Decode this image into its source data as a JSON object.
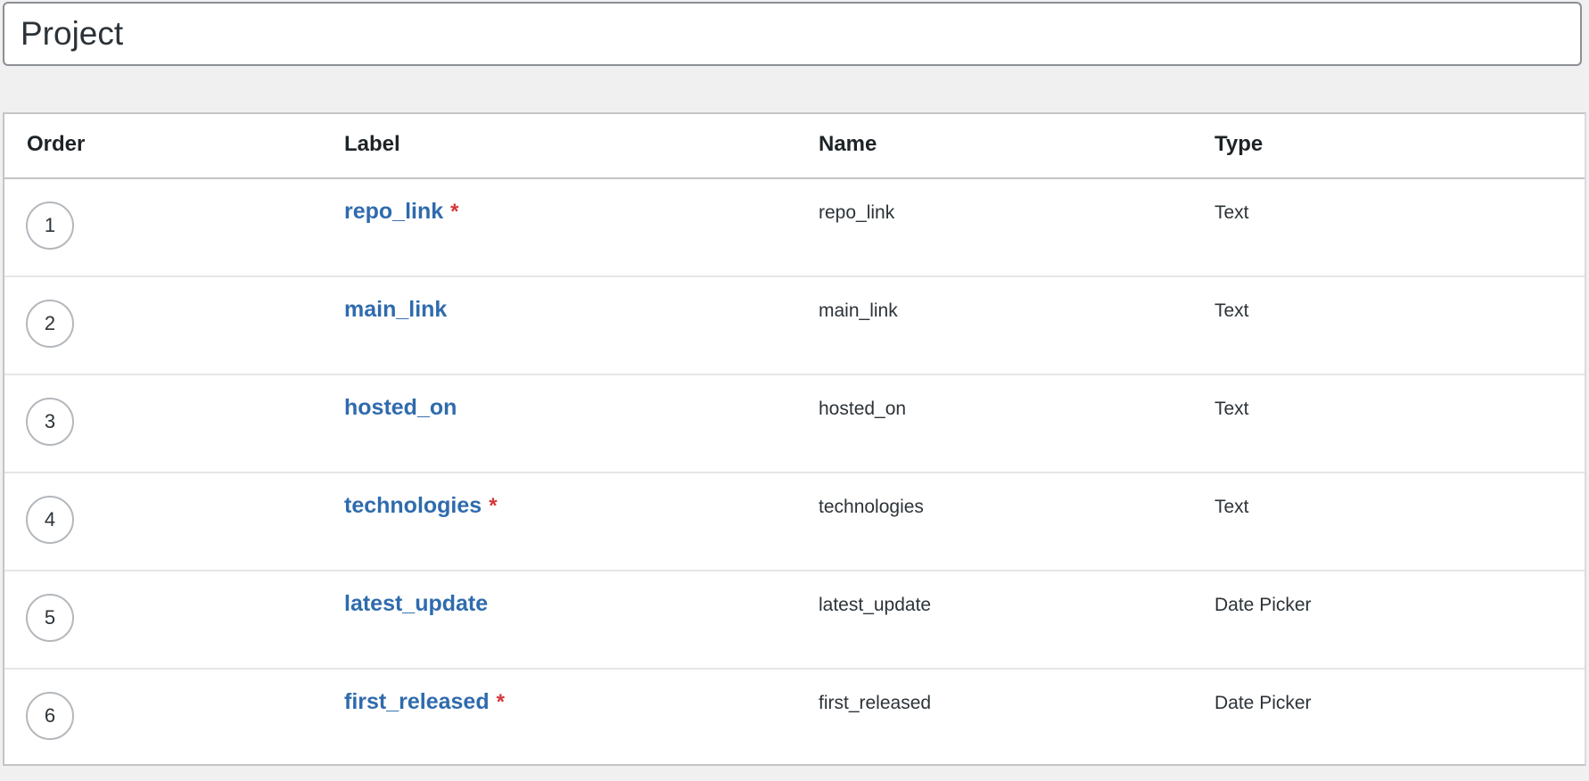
{
  "title_input": {
    "value": "Project"
  },
  "table": {
    "headers": {
      "order": "Order",
      "label": "Label",
      "name": "Name",
      "type": "Type"
    },
    "rows": [
      {
        "order": "1",
        "label": "repo_link",
        "required": true,
        "name": "repo_link",
        "type": "Text"
      },
      {
        "order": "2",
        "label": "main_link",
        "required": false,
        "name": "main_link",
        "type": "Text"
      },
      {
        "order": "3",
        "label": "hosted_on",
        "required": false,
        "name": "hosted_on",
        "type": "Text"
      },
      {
        "order": "4",
        "label": "technologies",
        "required": true,
        "name": "technologies",
        "type": "Text"
      },
      {
        "order": "5",
        "label": "latest_update",
        "required": false,
        "name": "latest_update",
        "type": "Date Picker"
      },
      {
        "order": "6",
        "label": "first_released",
        "required": true,
        "name": "first_released",
        "type": "Date Picker"
      }
    ],
    "required_marker": "*"
  },
  "colors": {
    "link": "#2f6bad",
    "required": "#d63638",
    "background": "#f0f0f0"
  }
}
